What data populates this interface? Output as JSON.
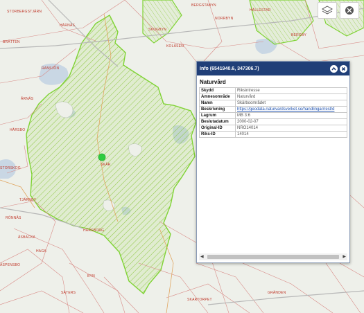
{
  "map": {
    "place_labels": [
      "BERGSTABYN",
      "STORBERGSTJÄRN",
      "HÄRNÄS",
      "BRÄTTEN",
      "RANSJÖN",
      "ÅRNÄS",
      "HÄRSBO",
      "SKÄR",
      "KOLÅSEN",
      "NORRBYN",
      "HÄLLESTAD",
      "BERGBY",
      "SKOGBYN",
      "STORSKOG",
      "TJÄRNBY",
      "RÖNNÅS",
      "ÅSBACKA",
      "HAGA",
      "BYN",
      "SÄTERS",
      "SKARTORPET",
      "GRÄNDEN",
      "ÄSPENSBO",
      "HÅRSBORG"
    ]
  },
  "popup": {
    "title": "Info (6541940.6, 347306.7)",
    "layer_title": "Naturvård",
    "rows": [
      {
        "key": "Skydd",
        "value": "Riksintresse",
        "link": false
      },
      {
        "key": "Ämnesområde",
        "value": "Naturvård",
        "link": false
      },
      {
        "key": "Namn",
        "value": "Skärboområdet",
        "link": false
      },
      {
        "key": "Beskrivning",
        "value": "https://geodata.naturvardsverket.se/handlingar/rest/d",
        "link": true
      },
      {
        "key": "Lagrum",
        "value": "MB 3:6",
        "link": false
      },
      {
        "key": "Beslutadatum",
        "value": "2000-02-07",
        "link": false
      },
      {
        "key": "Original-ID",
        "value": "NRO14014",
        "link": false
      },
      {
        "key": "Riks-ID",
        "value": "14014",
        "link": false
      }
    ]
  }
}
